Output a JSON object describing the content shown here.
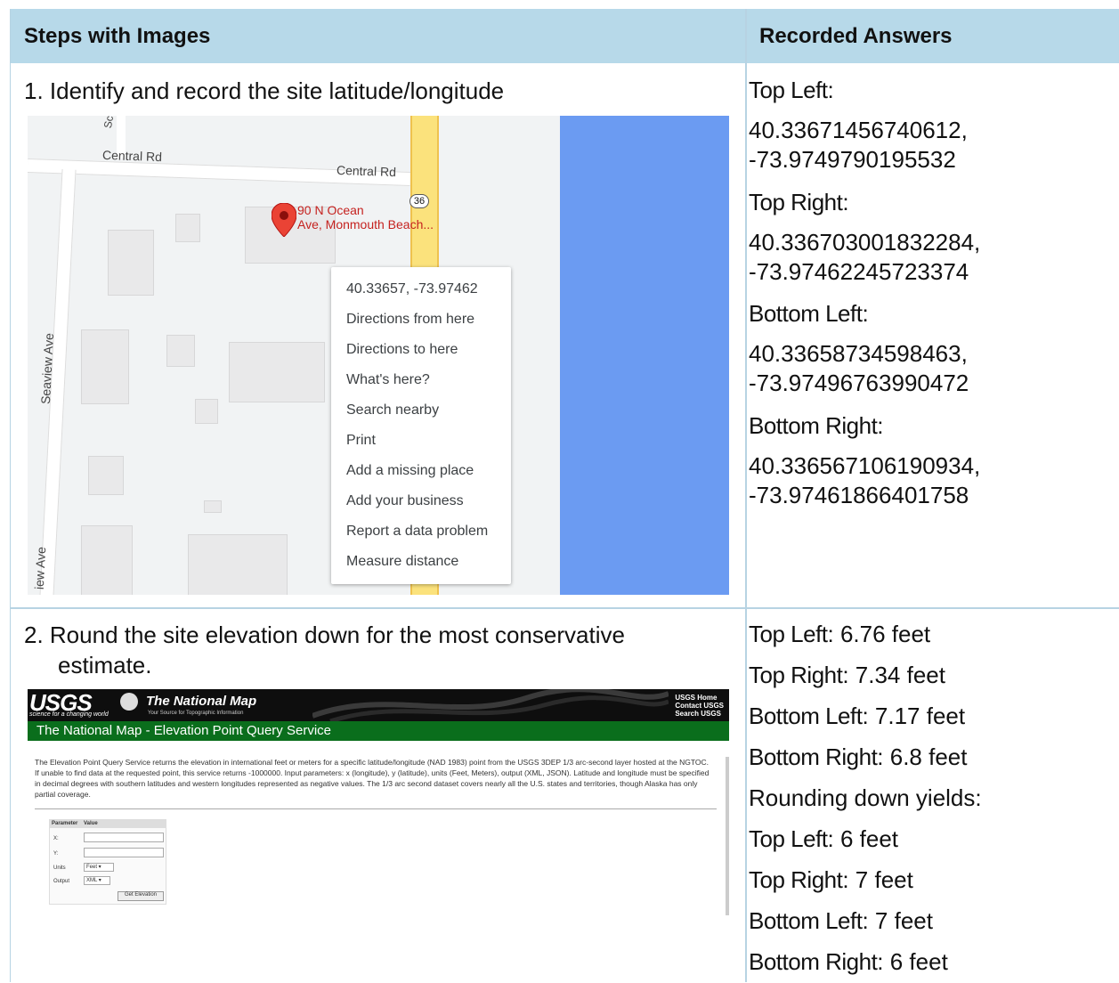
{
  "header": {
    "col1": "Steps with Images",
    "col2": "Recorded Answers"
  },
  "step1": {
    "text": "1.  Identify and record the site latitude/longitude",
    "map": {
      "streets": [
        "Central Rd",
        "Central Rd",
        "Seaview Ave",
        "iew Ave",
        "Sc"
      ],
      "route_shield": "36",
      "place_name_line1": "90 N Ocean",
      "place_name_line2": "Ave, Monmouth Beach...",
      "context_menu": [
        "40.33657, -73.97462",
        "Directions from here",
        "Directions to here",
        "What's here?",
        "Search nearby",
        "Print",
        "Add a missing place",
        "Add your business",
        "Report a data problem",
        "Measure distance"
      ]
    },
    "answers": [
      {
        "label": "Top Left",
        "value_line1": "40.33671456740612,",
        "value_line2": "-73.9749790195532"
      },
      {
        "label": "Top Right",
        "value_line1": "40.336703001832284,",
        "value_line2": "-73.97462245723374"
      },
      {
        "label": "Bottom Left",
        "value_line1": "40.33658734598463,",
        "value_line2": "-73.97496763990472"
      },
      {
        "label": "Bottom Right",
        "value_line1": "40.336567106190934,",
        "value_line2": "-73.97461866401758"
      }
    ]
  },
  "step2": {
    "text_line1": "2.  Round the site elevation down for the most conservative",
    "text_line2": "estimate.",
    "usgs": {
      "logo": "USGS",
      "tagline": "science for a changing world",
      "national_map": "The National Map",
      "national_map_sub": "Your Source for Topographic Information",
      "links": [
        "USGS Home",
        "Contact USGS",
        "Search USGS"
      ],
      "title": "The National Map - Elevation Point Query Service",
      "desc_bold": "Elevation Point Query Service",
      "desc": "The Elevation Point Query Service returns the elevation in international feet or meters for a specific latitude/longitude (NAD 1983) point from the USGS 3DEP 1/3 arc-second layer hosted at the NGTOC. If unable to find data at the requested point, this service returns -1000000. Input parameters: x (longitude), y (latitude), units (Feet, Meters), output (XML, JSON). Latitude and longitude must be specified in decimal degrees with southern latitudes and western longitudes represented as negative values. The 1/3 arc second dataset covers nearly all the U.S. states and territories, though Alaska has only partial coverage.",
      "form": {
        "col_param": "Parameter",
        "col_value": "Value",
        "x": "X:",
        "y": "Y:",
        "units": "Units",
        "units_val": "Feet",
        "output": "Output",
        "output_val": "XML",
        "button": "Get Elevation"
      }
    },
    "answers": [
      {
        "label": "Top Left",
        "value": ": 6.76 feet"
      },
      {
        "label": "Top Right",
        "value": ": 7.34 feet"
      },
      {
        "label": "Bottom Left",
        "value": ": 7.17 feet"
      },
      {
        "label": "Bottom Right",
        "value": ": 6.8 feet"
      }
    ],
    "rounding_label": "Rounding down yields:",
    "rounded": [
      {
        "label": "Top Left",
        "value": ": 6 feet"
      },
      {
        "label": "Top Right",
        "value": ": 7 feet"
      },
      {
        "label": "Bottom Left",
        "value": ": 7 feet"
      },
      {
        "label": "Bottom Right",
        "value": ": 6 feet"
      }
    ]
  }
}
